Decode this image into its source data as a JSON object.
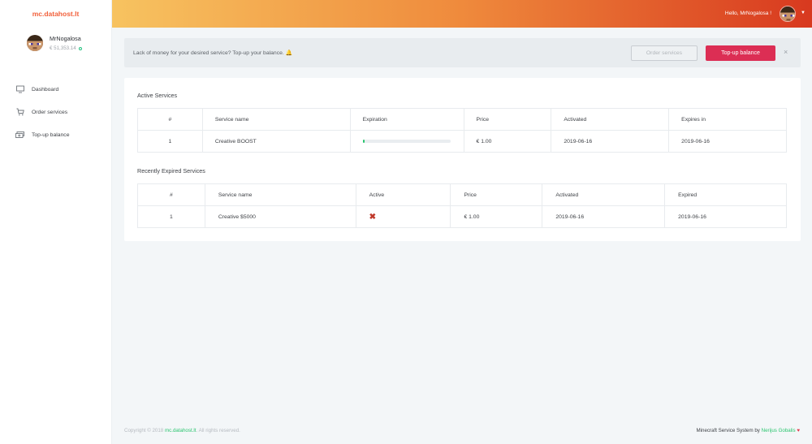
{
  "brand": {
    "name": "mc.datahost.lt"
  },
  "profile": {
    "name": "MrNogalosa",
    "balance": "€ 51,353.14"
  },
  "nav": [
    {
      "label": "Dashboard",
      "icon": "monitor-icon"
    },
    {
      "label": "Order services",
      "icon": "cart-icon"
    },
    {
      "label": "Top-up balance",
      "icon": "money-icon"
    }
  ],
  "topbar": {
    "greeting": "Hello, MrNogalosa !"
  },
  "alert": {
    "message": "Lack of money for your desired service? Top-up your balance. 🔔",
    "order_label": "Order services",
    "topup_label": "Top-up balance",
    "close_label": "×"
  },
  "active_services": {
    "title": "Active Services",
    "headers": [
      "#",
      "Service name",
      "Expiration",
      "Price",
      "Activated",
      "Expires in"
    ],
    "rows": [
      {
        "idx": "1",
        "name": "Creative BOOST",
        "expiration_progress": 0.02,
        "price": "€ 1.00",
        "activated": "2019-06-16",
        "expires": "2019-06-16"
      }
    ]
  },
  "expired_services": {
    "title": "Recently Expired Services",
    "headers": [
      "#",
      "Service name",
      "Active",
      "Price",
      "Activated",
      "Expired"
    ],
    "rows": [
      {
        "idx": "1",
        "name": "Creative $5000",
        "active_icon": "x-mark-icon",
        "price": "€ 1.00",
        "activated": "2019-06-16",
        "expired": "2019-06-16"
      }
    ]
  },
  "footer": {
    "copyright_prefix": "Copyright © 2018",
    "copyright_link": "mc.datahost.lt",
    "copyright_suffix": ". All rights reserved.",
    "system_text": "Minecraft Service System by",
    "author": "Nerijus Gobalis",
    "heart": "♥"
  },
  "colors": {
    "accent": "#f2603b",
    "danger": "#dc2e54",
    "success": "#2bc56f"
  }
}
